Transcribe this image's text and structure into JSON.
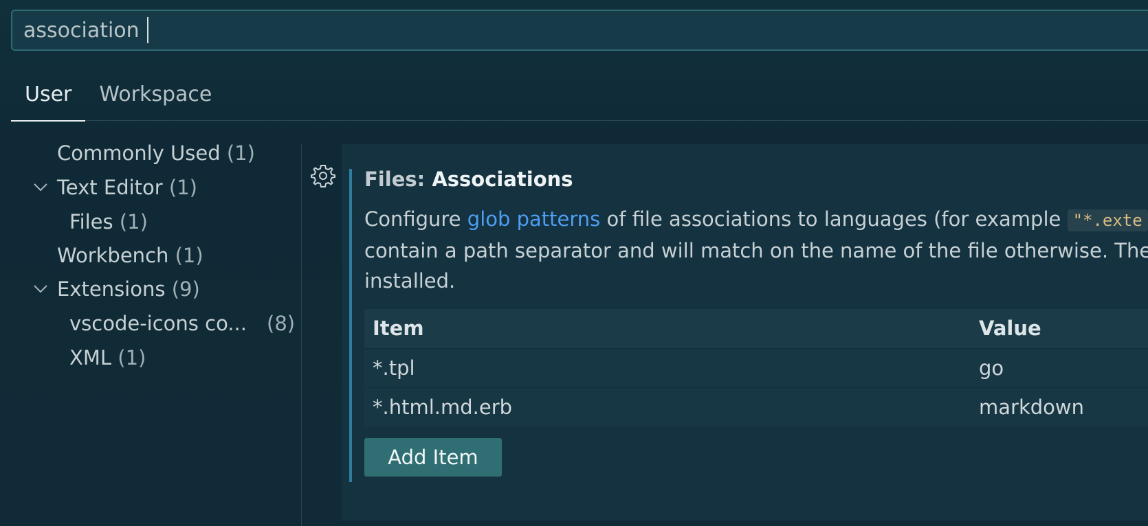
{
  "search": {
    "value": "association"
  },
  "tabs": [
    {
      "label": "User",
      "active": true
    },
    {
      "label": "Workspace",
      "active": false
    }
  ],
  "toc": {
    "items": [
      {
        "label": "Commonly Used",
        "count": "(1)",
        "level": 0,
        "expandable": false
      },
      {
        "label": "Text Editor",
        "count": "(1)",
        "level": 0,
        "expandable": true,
        "expanded": true
      },
      {
        "label": "Files",
        "count": "(1)",
        "level": 1,
        "expandable": false
      },
      {
        "label": "Workbench",
        "count": "(1)",
        "level": 0,
        "expandable": false
      },
      {
        "label": "Extensions",
        "count": "(9)",
        "level": 0,
        "expandable": true,
        "expanded": true
      },
      {
        "label": "vscode-icons co...",
        "count": "(8)",
        "level": 1,
        "expandable": false
      },
      {
        "label": "XML",
        "count": "(1)",
        "level": 1,
        "expandable": false
      }
    ]
  },
  "setting": {
    "category": "Files: ",
    "name": "Associations",
    "gear_icon": "gear-icon",
    "description": {
      "line1_prefix": "Configure ",
      "line1_link": "glob patterns",
      "line1_suffix": " of file associations to languages (for example ",
      "line1_code": "\"*.exte",
      "line2": "contain a path separator and will match on the name of the file otherwise. Thes",
      "line3": "installed."
    },
    "table": {
      "headers": {
        "item": "Item",
        "value": "Value"
      },
      "rows": [
        {
          "item": "*.tpl",
          "value": "go"
        },
        {
          "item": "*.html.md.erb",
          "value": "markdown"
        }
      ]
    },
    "add_button_label": "Add Item"
  },
  "colors": {
    "background": "#112a36",
    "accent": "#2f7ca1",
    "link": "#4e9ef2",
    "button": "#2f6f73"
  }
}
